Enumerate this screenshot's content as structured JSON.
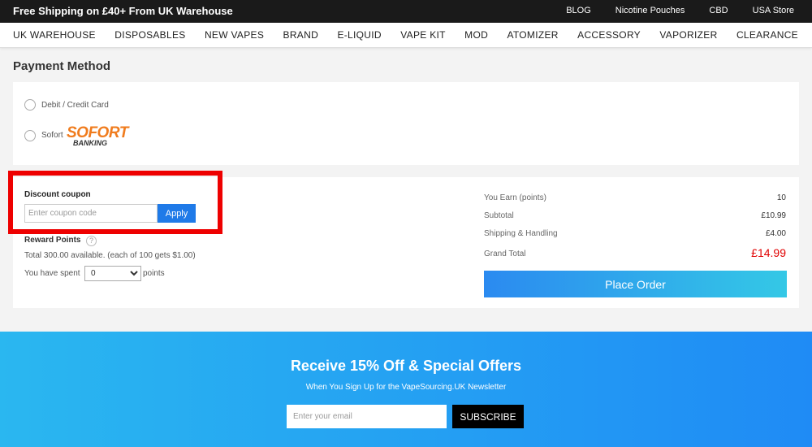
{
  "topbar": {
    "promo": "Free Shipping on £40+ From UK Warehouse",
    "links": [
      "BLOG",
      "Nicotine Pouches",
      "CBD",
      "USA Store"
    ]
  },
  "nav": [
    "UK WAREHOUSE",
    "DISPOSABLES",
    "NEW VAPES",
    "BRAND",
    "E-LIQUID",
    "VAPE KIT",
    "MOD",
    "ATOMIZER",
    "ACCESSORY",
    "VAPORIZER",
    "CLEARANCE"
  ],
  "payment": {
    "title": "Payment Method",
    "options": [
      {
        "label": "Debit / Credit Card"
      },
      {
        "label": "Sofort",
        "logo_text": "SOFORT",
        "logo_subtext": "BANKING"
      }
    ],
    "logo_color": "#f07c1e"
  },
  "coupon": {
    "label": "Discount coupon",
    "placeholder": "Enter coupon code",
    "apply_label": "Apply",
    "highlight_color": "#ee0000"
  },
  "reward": {
    "label": "Reward Points",
    "help_glyph": "?",
    "total_text": "Total 300.00 available. (each of 100 gets $1.00)",
    "spent_label": "You have spent",
    "selected_value": "0",
    "points_suffix": "points"
  },
  "summary": {
    "earn_label": "You Earn (points)",
    "earn_value": "10",
    "subtotal_label": "Subtotal",
    "subtotal_value": "£10.99",
    "shipping_label": "Shipping & Handling",
    "shipping_value": "£4.00",
    "grand_label": "Grand Total",
    "grand_value": "£14.99",
    "place_order_label": "Place Order",
    "accent_color": "#e00000"
  },
  "newsletter": {
    "title": "Receive 15% Off & Special Offers",
    "subtitle": "When You Sign Up for the VapeSourcing.UK Newsletter",
    "email_placeholder": "Enter your email",
    "subscribe_label": "SUBSCRIBE"
  }
}
